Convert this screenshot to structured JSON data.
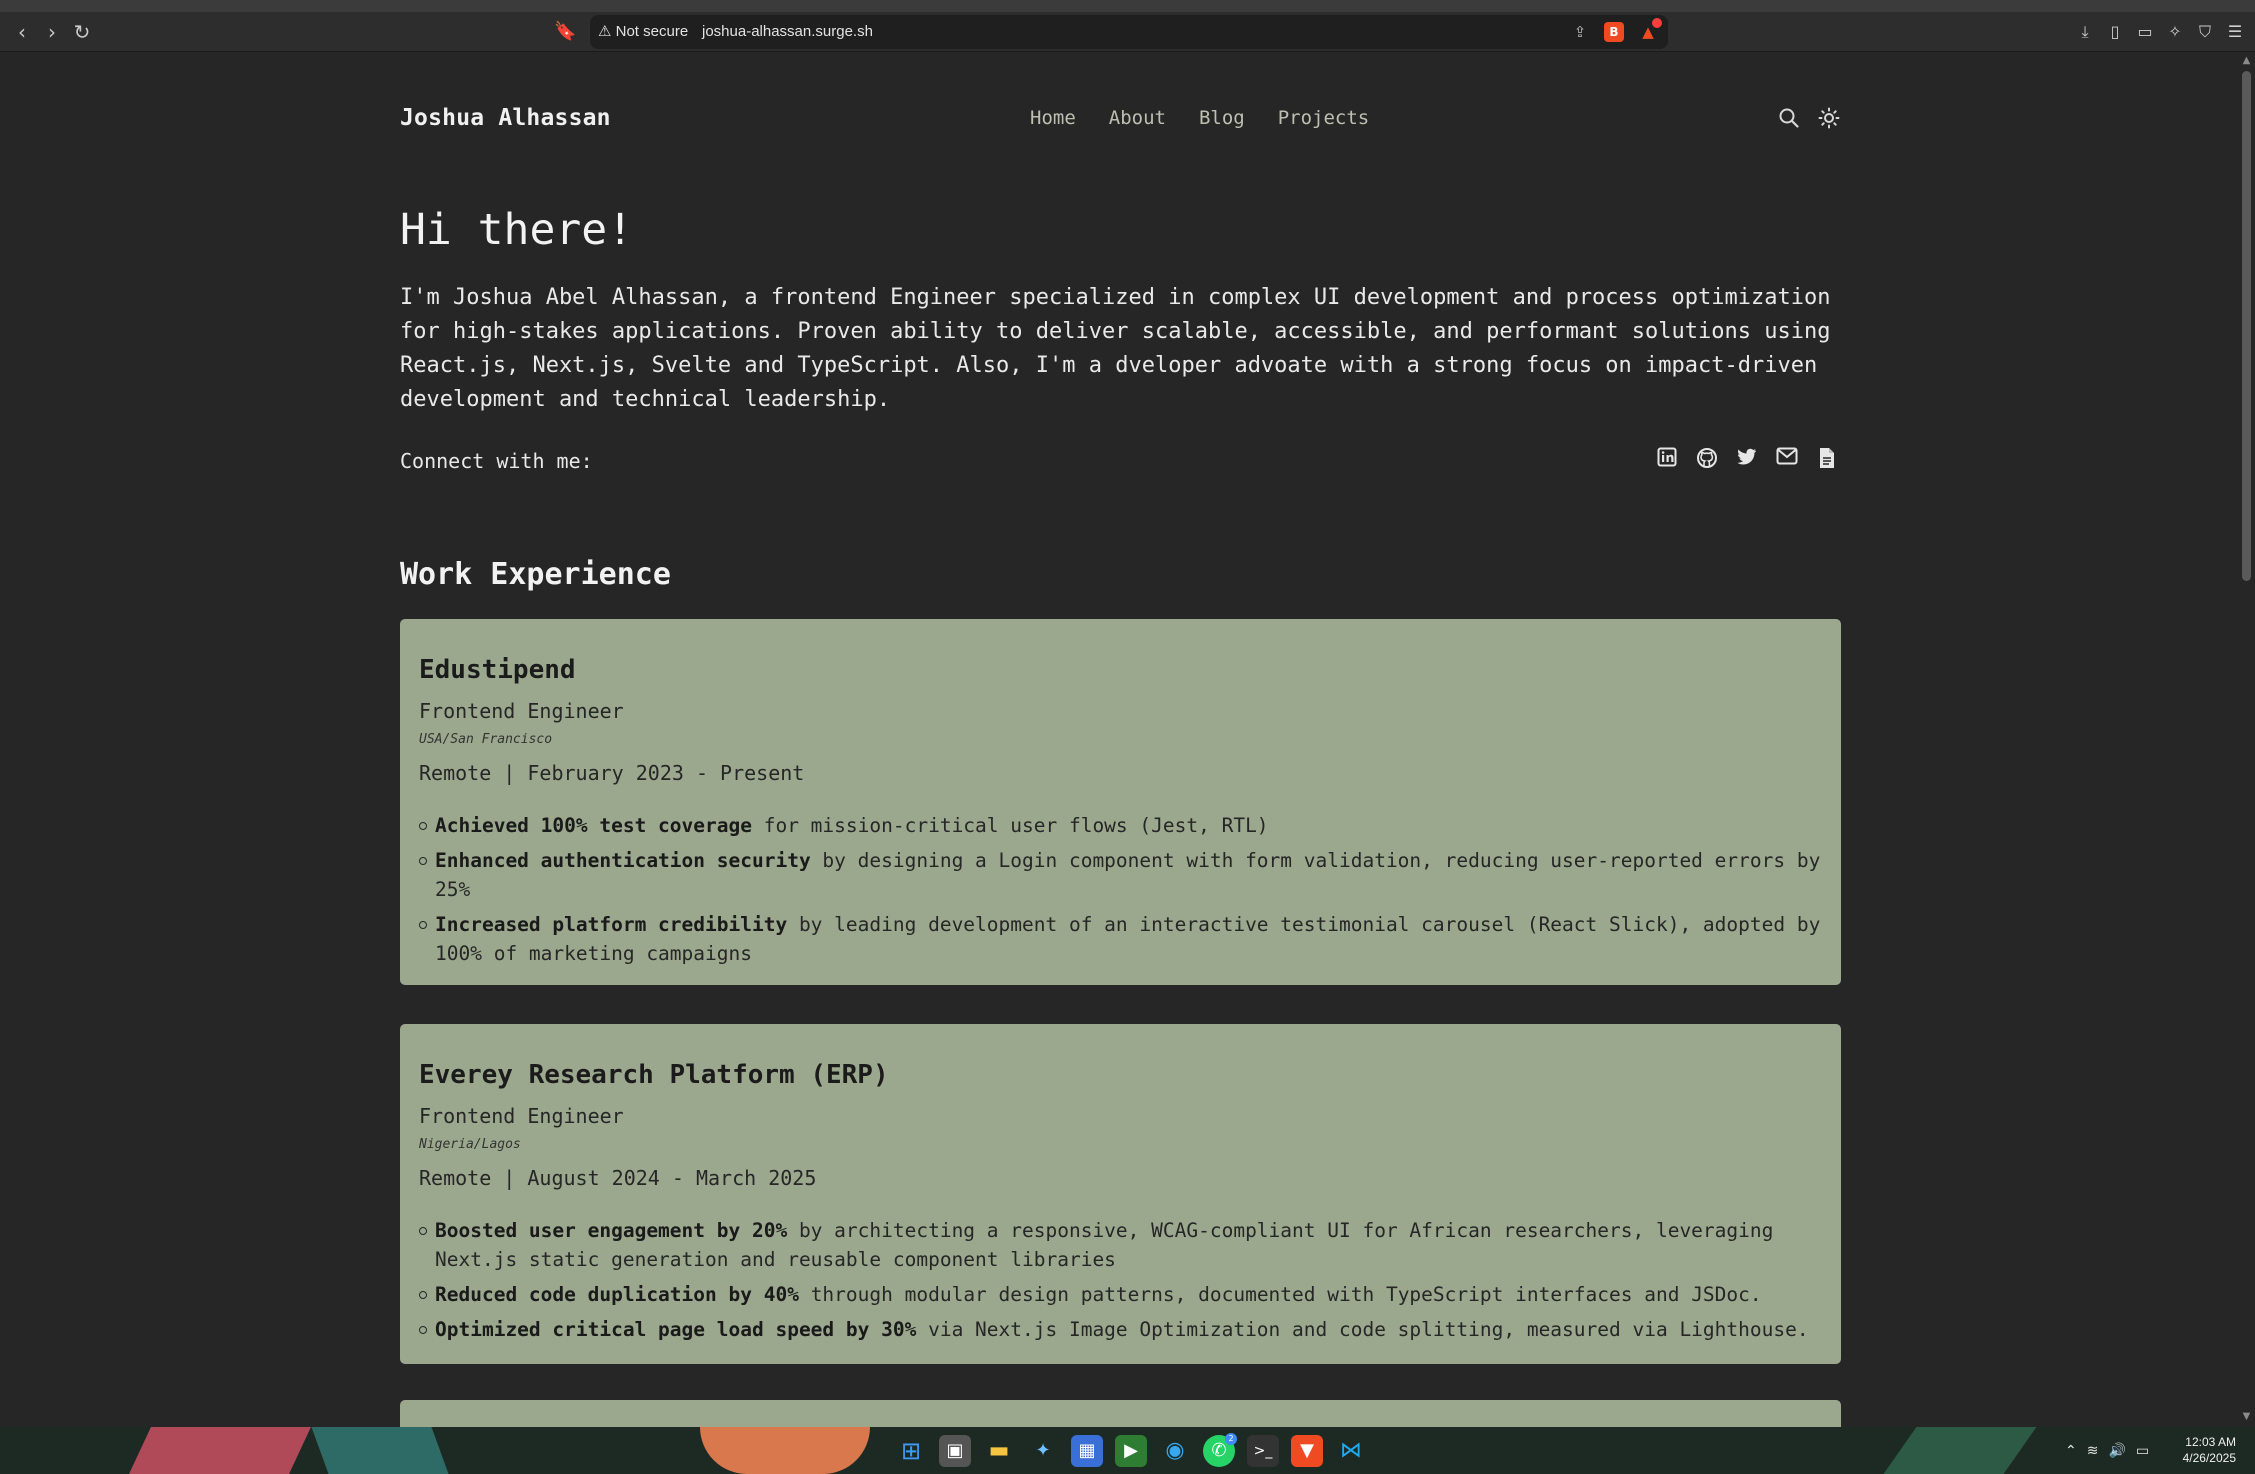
{
  "browser": {
    "security_label": "Not secure",
    "url": "joshua-alhassan.surge.sh",
    "shield_badge": "B"
  },
  "site": {
    "title": "Joshua Alhassan",
    "nav": [
      "Home",
      "About",
      "Blog",
      "Projects"
    ]
  },
  "hero": {
    "heading": "Hi there!",
    "intro": "I'm Joshua Abel Alhassan, a frontend Engineer specialized in complex UI development and process optimization for high-stakes applications. Proven ability to deliver scalable, accessible, and performant solutions using React.js, Next.js, Svelte and TypeScript. Also, I'm a dveloper advoate with a strong focus on impact-driven development and technical leadership.",
    "connect_label": "Connect with me:"
  },
  "work": {
    "title": "Work Experience",
    "jobs": [
      {
        "company": "Edustipend",
        "role": "Frontend Engineer",
        "location": "USA/San Francisco",
        "dates": "Remote | February 2023 - Present",
        "bullets": [
          {
            "bold": "Achieved 100% test coverage",
            "rest": " for mission-critical user flows (Jest, RTL)"
          },
          {
            "bold": "Enhanced authentication security",
            "rest": " by designing a Login component with form validation, reducing user-reported errors by 25%"
          },
          {
            "bold": "Increased platform credibility",
            "rest": " by leading development of an interactive testimonial carousel (React Slick), adopted by 100% of marketing campaigns"
          }
        ]
      },
      {
        "company": "Everey Research Platform (ERP)",
        "role": "Frontend Engineer",
        "location": "Nigeria/Lagos",
        "dates": "Remote | August 2024 - March 2025",
        "bullets": [
          {
            "bold": "Boosted user engagement by 20%",
            "rest": " by architecting a responsive, WCAG-compliant UI for African researchers, leveraging Next.js static generation and reusable component libraries"
          },
          {
            "bold": "Reduced code duplication by 40%",
            "rest": " through modular design patterns, documented with TypeScript interfaces and JSDoc."
          },
          {
            "bold": "Optimized critical page load speed by 30%",
            "rest": " via Next.js Image Optimization and code splitting, measured via Lighthouse."
          }
        ]
      }
    ]
  },
  "taskbar": {
    "time": "12:03 AM",
    "date": "4/26/2025",
    "whatsapp_badge": "2"
  },
  "colors": {
    "page_bg": "#262626",
    "card_bg": "#9ba88e",
    "nav_text": "#bdbfb0"
  }
}
